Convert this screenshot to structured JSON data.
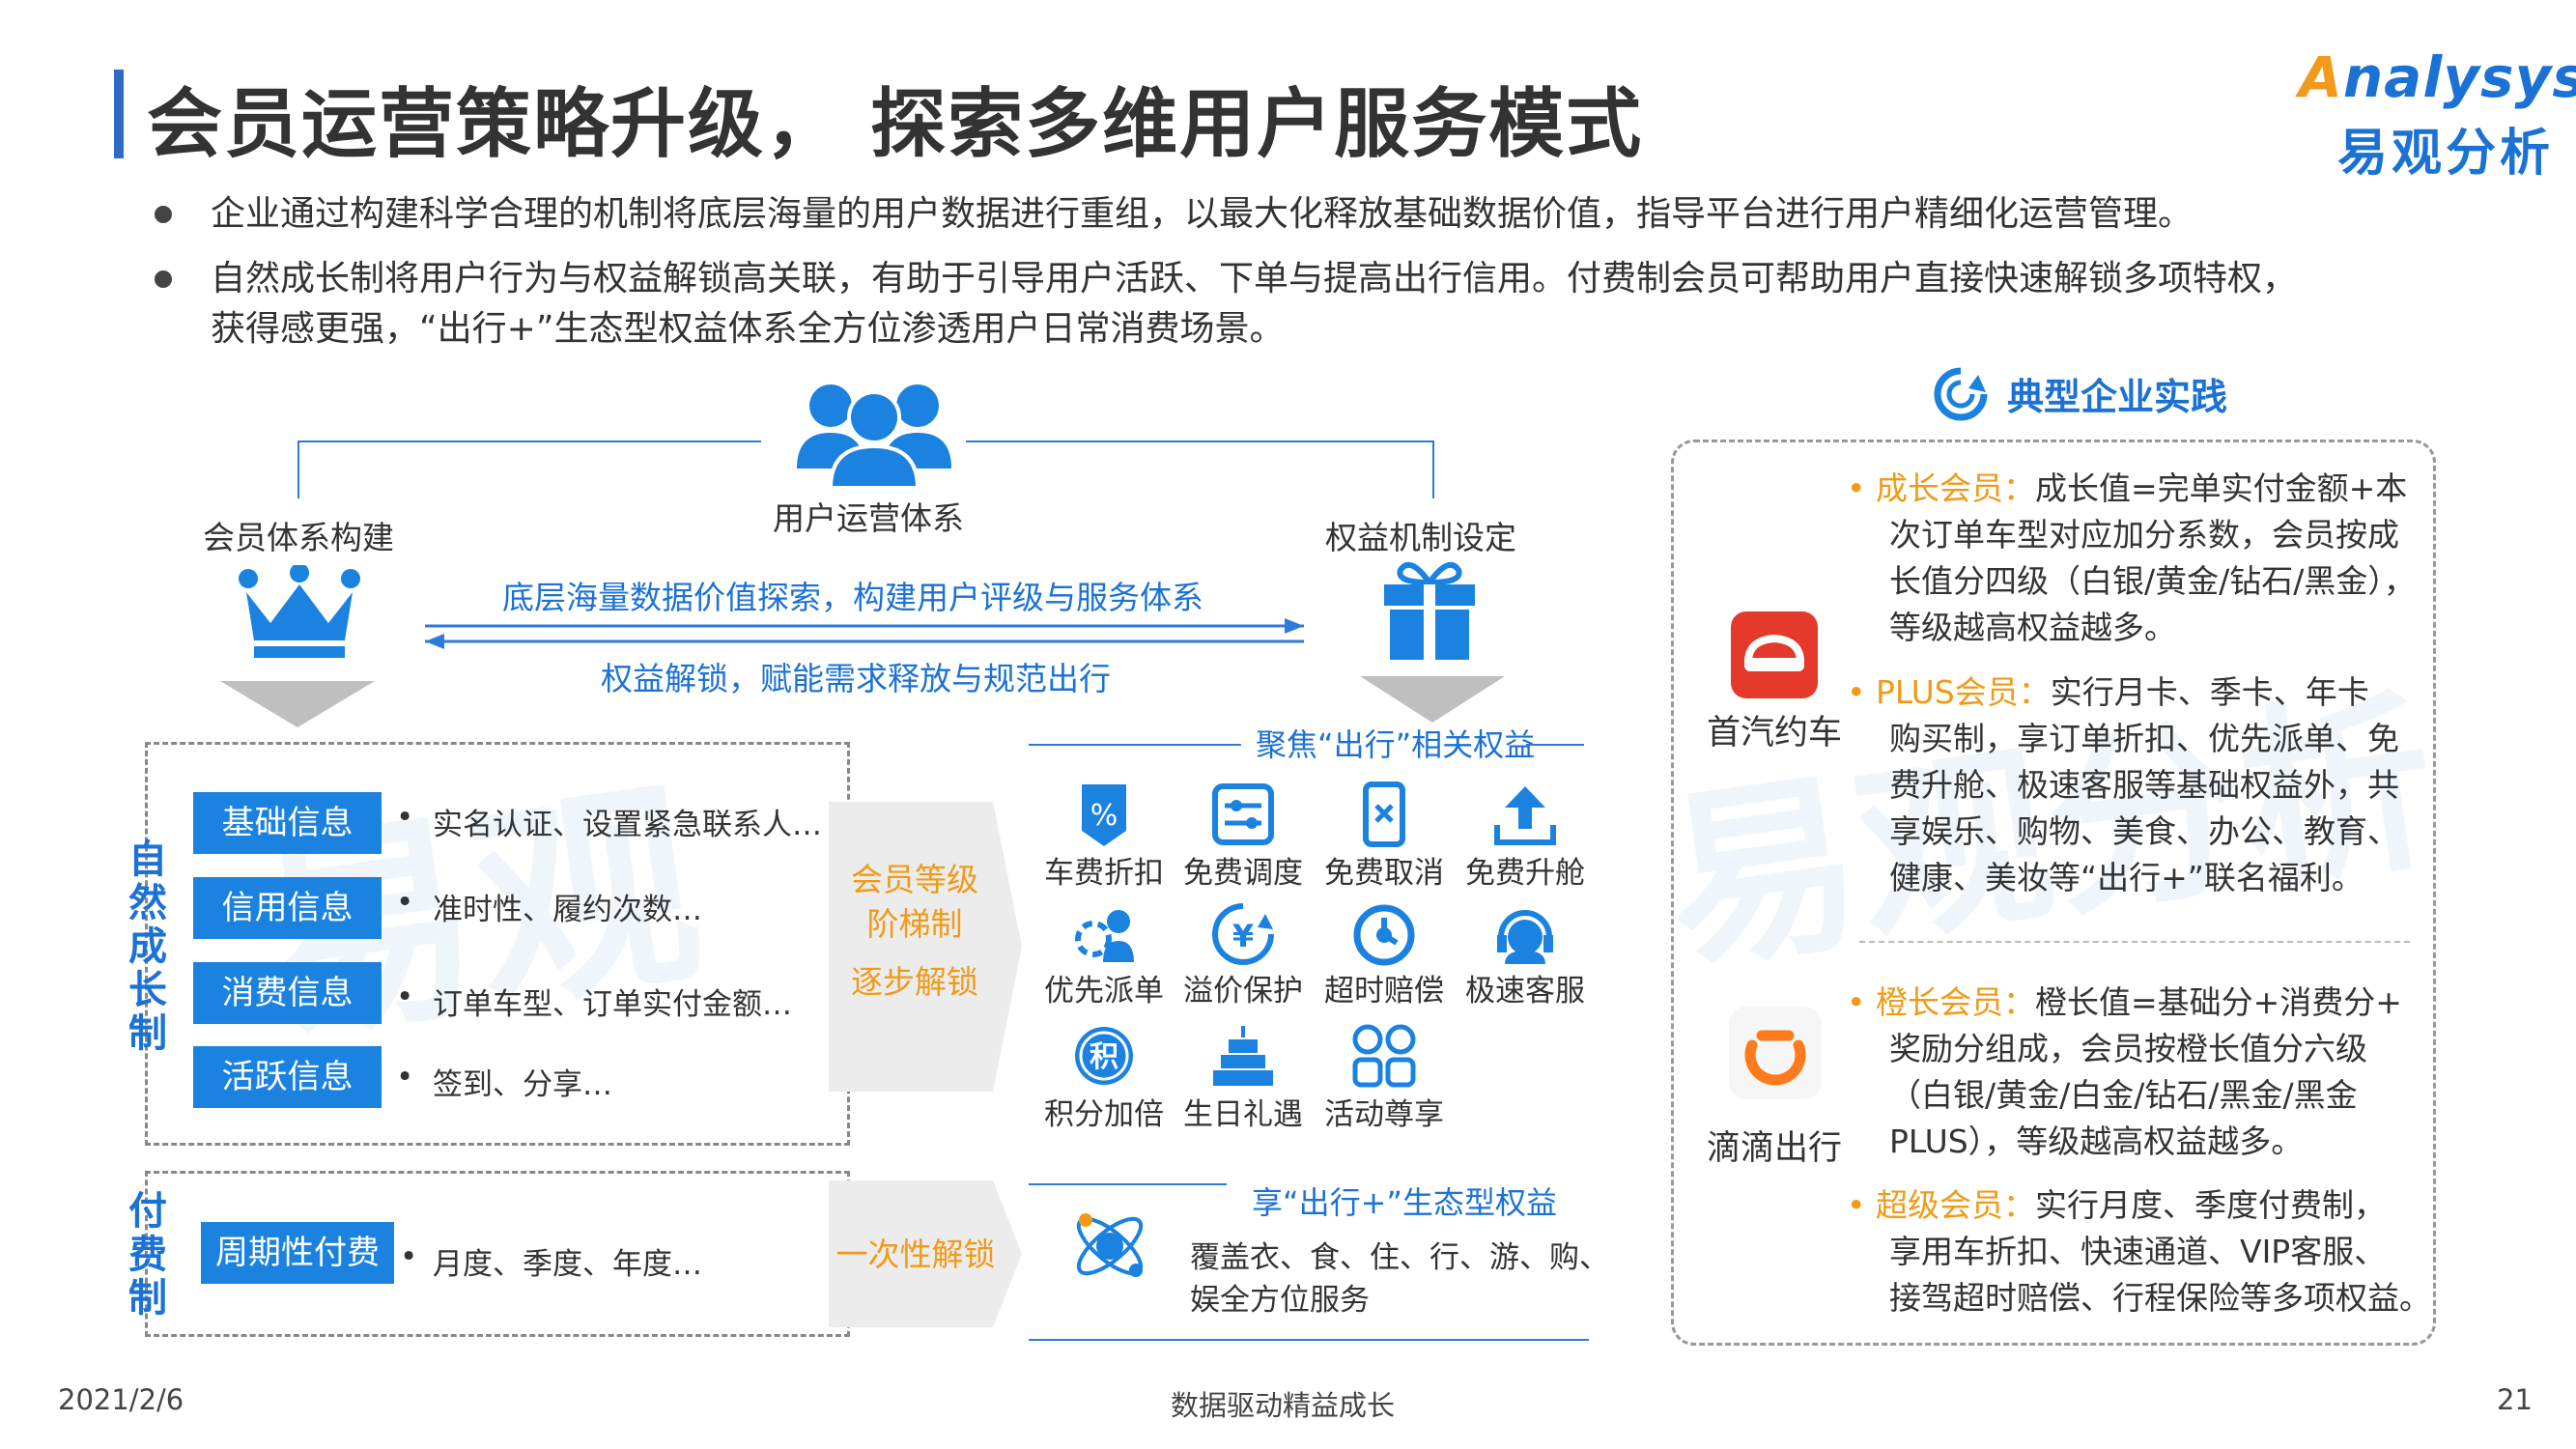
{
  "header": {
    "title": "会员运营策略升级， 探索多维用户服务模式",
    "logo_en": "nalysys",
    "logo_en_initial": "A",
    "logo_cn": "易观分析"
  },
  "bullets": [
    "企业通过构建科学合理的机制将底层海量的用户数据进行重组，以最大化释放基础数据价值，指导平台进行用户精细化运营管理。",
    "自然成长制将用户行为与权益解锁高关联，有助于引导用户活跃、下单与提高出行信用。付费制会员可帮助用户直接快速解锁多项特权，",
    "获得感更强，“出行+”生态型权益体系全方位渗透用户日常消费场景。"
  ],
  "diagram": {
    "center_label": "用户运营体系",
    "left_label": "会员体系构建",
    "right_label": "权益机制设定",
    "arrow_top_text": "底层海量数据价值探索，构建用户评级与服务体系",
    "arrow_bottom_text": "权益解锁，赋能需求释放与规范出行",
    "natural": {
      "title": "自然成长制",
      "rows": [
        {
          "tag": "基础信息",
          "desc": "实名认证、设置紧急联系人…"
        },
        {
          "tag": "信用信息",
          "desc": "准时性、履约次数…"
        },
        {
          "tag": "消费信息",
          "desc": "订单车型、订单实付金额…"
        },
        {
          "tag": "活跃信息",
          "desc": "签到、分享…"
        }
      ],
      "arrow_lines": [
        "会员等级",
        "阶梯制",
        "逐步解锁"
      ]
    },
    "paid": {
      "title": "付费制",
      "tag": "周期性付费",
      "desc": "月度、季度、年度…",
      "arrow_text": "一次性解锁"
    },
    "rights_header": "聚焦“出行”相关权益",
    "rights": [
      "车费折扣",
      "免费调度",
      "免费取消",
      "免费升舱",
      "优先派单",
      "溢价保护",
      "超时赔偿",
      "极速客服",
      "积分加倍",
      "生日礼遇",
      "活动尊享"
    ],
    "eco_header": "享“出行+”生态型权益",
    "eco_text_1": "覆盖衣、食、住、行、游、购、",
    "eco_text_2": "娱全方位服务",
    "bullet_char": "•"
  },
  "practice": {
    "title": "典型企业实践",
    "companies": [
      {
        "name": "首汽约车",
        "items": [
          {
            "label": "成长会员：",
            "lines": [
              "成长值=完单实付金额+本",
              "次订单车型对应加分系数，会员按成",
              "长值分四级（白银/黄金/钻石/黑金），",
              "等级越高权益越多。"
            ]
          },
          {
            "label": "PLUS会员：",
            "lines": [
              "实行月卡、季卡、年卡",
              "购买制，享订单折扣、优先派单、免",
              "费升舱、极速客服等基础权益外，共",
              "享娱乐、购物、美食、办公、教育、",
              "健康、美妆等“出行+”联名福利。"
            ]
          }
        ]
      },
      {
        "name": "滴滴出行",
        "items": [
          {
            "label": "橙长会员：",
            "lines": [
              "橙长值=基础分+消费分+",
              "奖励分组成，会员按橙长值分六级",
              "（白银/黄金/白金/钻石/黑金/黑金",
              "PLUS），等级越高权益越多。"
            ]
          },
          {
            "label": "超级会员：",
            "lines": [
              "实行月度、季度付费制，",
              "享用车折扣、快速通道、VIP客服、",
              "接驾超时赔偿、行程保险等多项权益。"
            ]
          }
        ]
      }
    ]
  },
  "footer": {
    "date": "2021/2/6",
    "center": "数据驱动精益成长",
    "page": "21"
  },
  "colors": {
    "accent_blue": "#1b82e0",
    "orange": "#f19a18",
    "title_bar": "#2e6bc6"
  }
}
